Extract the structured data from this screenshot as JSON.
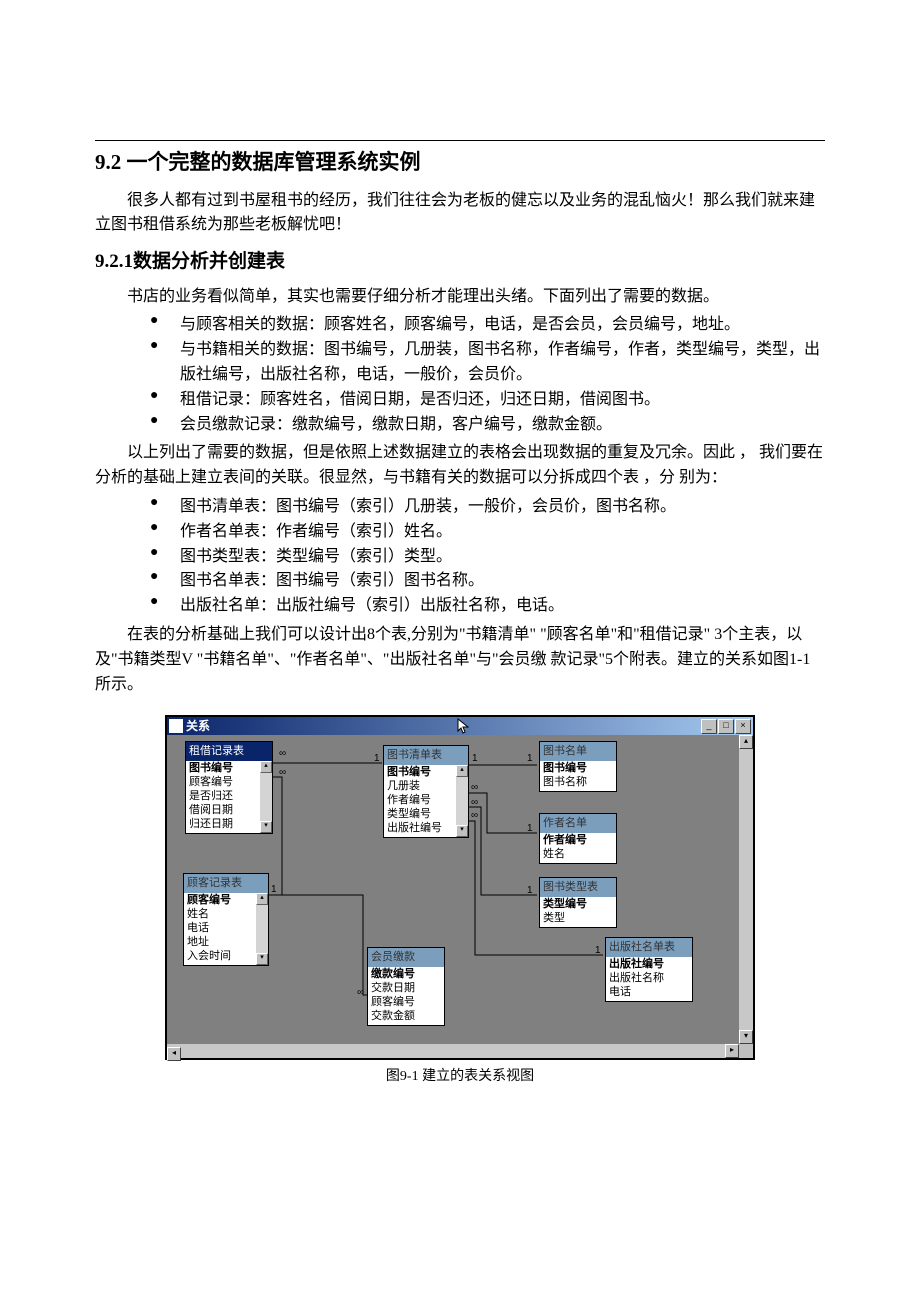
{
  "section_title": "9.2 一个完整的数据库管理系统实例",
  "intro_p": "很多人都有过到书屋租书的经历，我们往往会为老板的健忘以及业务的混乱恼火！那么我们就来建立图书租借系统为那些老板解忧吧！",
  "subsection_title": "9.2.1数据分析并创建表",
  "p1": "书店的业务看似简单，其实也需要仔细分析才能理出头绪。下面列出了需要的数据。",
  "list1": [
    "与顾客相关的数据：顾客姓名，顾客编号，电话，是否会员，会员编号，地址。",
    "与书籍相关的数据：图书编号，几册装，图书名称，作者编号，作者，类型编号，类型，出版社编号，出版社名称，电话，一般价，会员价。",
    "租借记录：顾客姓名，借阅日期，是否归还，归还日期，借阅图书。",
    "会员缴款记录：缴款编号，缴款日期，客户编号，缴款金额。"
  ],
  "p2": "以上列出了需要的数据，但是依照上述数据建立的表格会出现数据的重复及冗余。因此 ，  我们要在分析的基础上建立表间的关联。很显然，与书籍有关的数据可以分拆成四个表 ，分   别为：",
  "list2": [
    "图书清单表：图书编号（索引）几册装，一般价，会员价，图书名称。",
    "作者名单表：作者编号（索引）姓名。",
    "图书类型表：类型编号（索引）类型。",
    "图书名单表：图书编号（索引）图书名称。",
    "出版社名单：出版社编号（索引）出版社名称，电话。"
  ],
  "p3": "在表的分析基础上我们可以设计出8个表,分别为\"书籍清单\"   \"顾客名单\"和\"租借记录\"  3个主表，以及\"书籍类型V  \"书籍名单\"、\"作者名单\"、\"出版社名单\"与\"会员缴   款记录\"5个附表。建立的关系如图1-1所示。",
  "figure": {
    "window_title": "关系",
    "caption": "图9-1     建立的表关系视图",
    "tables": {
      "rent": {
        "title": "租借记录表",
        "fields": [
          "图书编号",
          "顾客编号",
          "是否归还",
          "借阅日期",
          "归还日期"
        ]
      },
      "booklist": {
        "title": "图书清单表",
        "fields": [
          "图书编号",
          "几册装",
          "作者编号",
          "类型编号",
          "出版社编号"
        ]
      },
      "bookname": {
        "title": "图书名单",
        "fields": [
          "图书编号",
          "图书名称"
        ]
      },
      "author": {
        "title": "作者名单",
        "fields": [
          "作者编号",
          "姓名"
        ]
      },
      "customer": {
        "title": "顾客记录表",
        "fields": [
          "顾客编号",
          "姓名",
          "电话",
          "地址",
          "入会时间"
        ]
      },
      "booktype": {
        "title": "图书类型表",
        "fields": [
          "类型编号",
          "类型"
        ]
      },
      "fee": {
        "title": "会员缴款",
        "fields": [
          "缴款编号",
          "交款日期",
          "顾客编号",
          "交款金额"
        ]
      },
      "publisher": {
        "title": "出版社名单表",
        "fields": [
          "出版社编号",
          "出版社名称",
          "电话"
        ]
      }
    }
  }
}
